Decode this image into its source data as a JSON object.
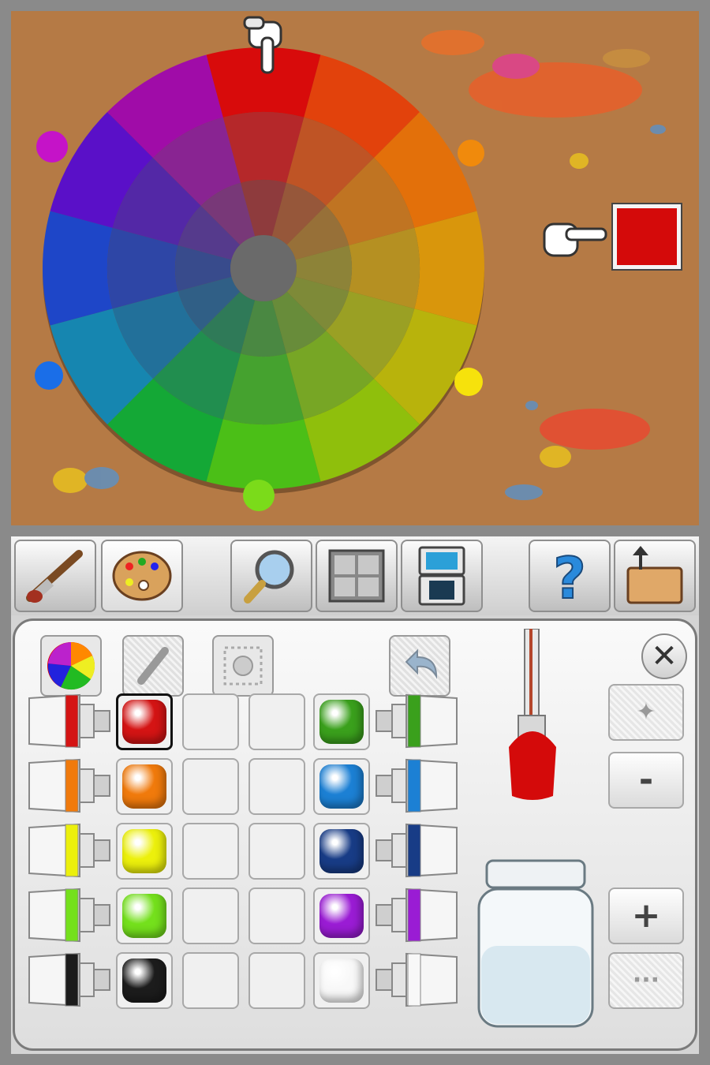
{
  "wheel": {
    "segments": 12,
    "ring_colors": [
      [
        "#d80b0b",
        "#e2420c",
        "#e3700a",
        "#d9960c",
        "#b8b30c",
        "#8fbf0c",
        "#4bbf17",
        "#14a836",
        "#1686b0",
        "#1e46c8",
        "#5a10c8",
        "#a00ca8",
        "#d40c6a"
      ],
      [
        "#b82020",
        "#c44a1c",
        "#c5701c",
        "#b98f1c",
        "#9da31c",
        "#7aa81c",
        "#46a428",
        "#1c9048",
        "#1c6c98",
        "#2a40a8",
        "#5420a8",
        "#8a1c8e",
        "#b41c5c"
      ]
    ],
    "outer_colors": [
      "#d80b0b",
      "#e2420c",
      "#e3700a",
      "#d9960c",
      "#b8b30c",
      "#8fbf0c",
      "#4bbf17",
      "#14a836",
      "#1686b0",
      "#1e46c8",
      "#5a10c8",
      "#a00ca8"
    ],
    "middle_colors": [
      "#b5282a",
      "#bf5425",
      "#c07422",
      "#b59022",
      "#9aa024",
      "#77a625",
      "#45a22f",
      "#218e4f",
      "#22709a",
      "#2e46a6",
      "#5328a6",
      "#892492"
    ],
    "inner_colors": [
      "#8e3b3d",
      "#96573a",
      "#977038",
      "#8d8338",
      "#7e8a38",
      "#688c3a",
      "#4a8842",
      "#2f7a58",
      "#305f86",
      "#384b8c",
      "#553a8c",
      "#783878"
    ],
    "center_color": "#6a6a6a",
    "marker_colors": [
      "#c513c8",
      "#f08a0c",
      "#1a6ee8",
      "#f6e20c",
      "#7bdb1a"
    ]
  },
  "selected_color": "#d40a0a",
  "paints": {
    "left": [
      {
        "name": "red",
        "color": "#d41414"
      },
      {
        "name": "orange",
        "color": "#f07a0c"
      },
      {
        "name": "yellow",
        "color": "#ecf00c"
      },
      {
        "name": "lime",
        "color": "#74e01c"
      },
      {
        "name": "black",
        "color": "#1c1c1c"
      }
    ],
    "right": [
      {
        "name": "green",
        "color": "#3aa01c"
      },
      {
        "name": "sky-blue",
        "color": "#1c80d4"
      },
      {
        "name": "navy",
        "color": "#183c86"
      },
      {
        "name": "purple",
        "color": "#9a1cd4"
      },
      {
        "name": "white",
        "color": "#f8f8f8"
      }
    ]
  },
  "side_buttons": {
    "minus_label": "-",
    "plus_label": "+",
    "close_label": "✕"
  },
  "tabs": [
    {
      "icon": "brush-icon"
    },
    {
      "icon": "palette-icon"
    },
    {
      "icon": "magnifier-icon"
    },
    {
      "icon": "grid-icon"
    },
    {
      "icon": "ds-screens-icon"
    },
    {
      "icon": "help-icon"
    },
    {
      "icon": "export-folder-icon"
    }
  ]
}
